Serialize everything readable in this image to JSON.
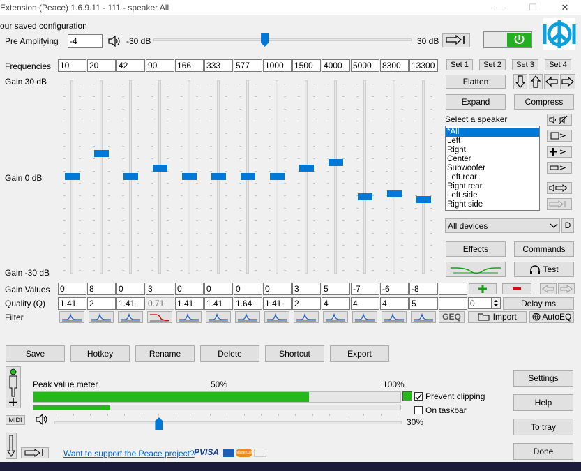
{
  "window": {
    "title": "Extension (Peace) 1.6.9.11 - 111 - speaker All",
    "minimize": "—",
    "maximize": "☐",
    "close": "✕"
  },
  "subtitle": "our saved configuration",
  "preamp": {
    "label": "Pre Amplifying",
    "value": "-4",
    "min_label": "-30 dB",
    "max_label": "30 dB",
    "level_fraction": 0.43
  },
  "frequencies": {
    "label": "Frequencies",
    "values": [
      "10",
      "20",
      "42",
      "90",
      "166",
      "333",
      "577",
      "1000",
      "1500",
      "4000",
      "5000",
      "8300",
      "13300"
    ]
  },
  "sets": [
    "Set 1",
    "Set 2",
    "Set 3",
    "Set 4"
  ],
  "gain": {
    "top_label": "Gain 30 dB",
    "mid_label": "Gain 0 dB",
    "bottom_label": "Gain -30 dB",
    "min": -30,
    "max": 30
  },
  "gain_values": {
    "label": "Gain Values",
    "values": [
      "0",
      "8",
      "0",
      "3",
      "0",
      "0",
      "0",
      "0",
      "3",
      "5",
      "-7",
      "-6",
      "-8",
      ""
    ]
  },
  "quality": {
    "label": "Quality (Q)",
    "values": [
      "1.41",
      "2",
      "1.41",
      "0.71",
      "1.41",
      "1.41",
      "1.64",
      "1.41",
      "2",
      "4",
      "4",
      "4",
      "5",
      ""
    ],
    "extra": "0"
  },
  "filter": {
    "label": "Filter",
    "geq": "GEQ"
  },
  "buttons": {
    "flatten": "Flatten",
    "expand": "Expand",
    "compress": "Compress",
    "effects": "Effects",
    "commands": "Commands",
    "test": "Test",
    "delay": "Delay ms",
    "import": "Import",
    "autoeq": "AutoEQ",
    "d": "D",
    "save": "Save",
    "hotkey": "Hotkey",
    "rename": "Rename",
    "delete": "Delete",
    "shortcut": "Shortcut",
    "export": "Export",
    "settings": "Settings",
    "help": "Help",
    "totray": "To tray",
    "done": "Done",
    "midi": "MIDI"
  },
  "speaker": {
    "label": "Select a speaker",
    "items": [
      "*All",
      "Left",
      "Right",
      "Center",
      "Subwoofer",
      "Left rear",
      "Right rear",
      "Left side",
      "Right side"
    ],
    "selected": 0
  },
  "devices": {
    "selected": "All devices"
  },
  "meter": {
    "label": "Peak value meter",
    "mid": "50%",
    "max": "100%",
    "peak_fraction": 0.75,
    "level2_fraction": 0.21
  },
  "volume": {
    "label": "30%",
    "fraction": 0.3
  },
  "options": {
    "prevent_clipping": "Prevent clipping",
    "prevent_checked": true,
    "on_taskbar": "On taskbar",
    "taskbar_checked": false
  },
  "support_link": "Want to support the Peace project?",
  "payment": {
    "paypal": "PVISA",
    "mc": "MasterCard"
  },
  "colors": {
    "accent": "#0078d7",
    "power_on": "#22b01e",
    "meter": "#26b81b",
    "link": "#0066cc"
  }
}
